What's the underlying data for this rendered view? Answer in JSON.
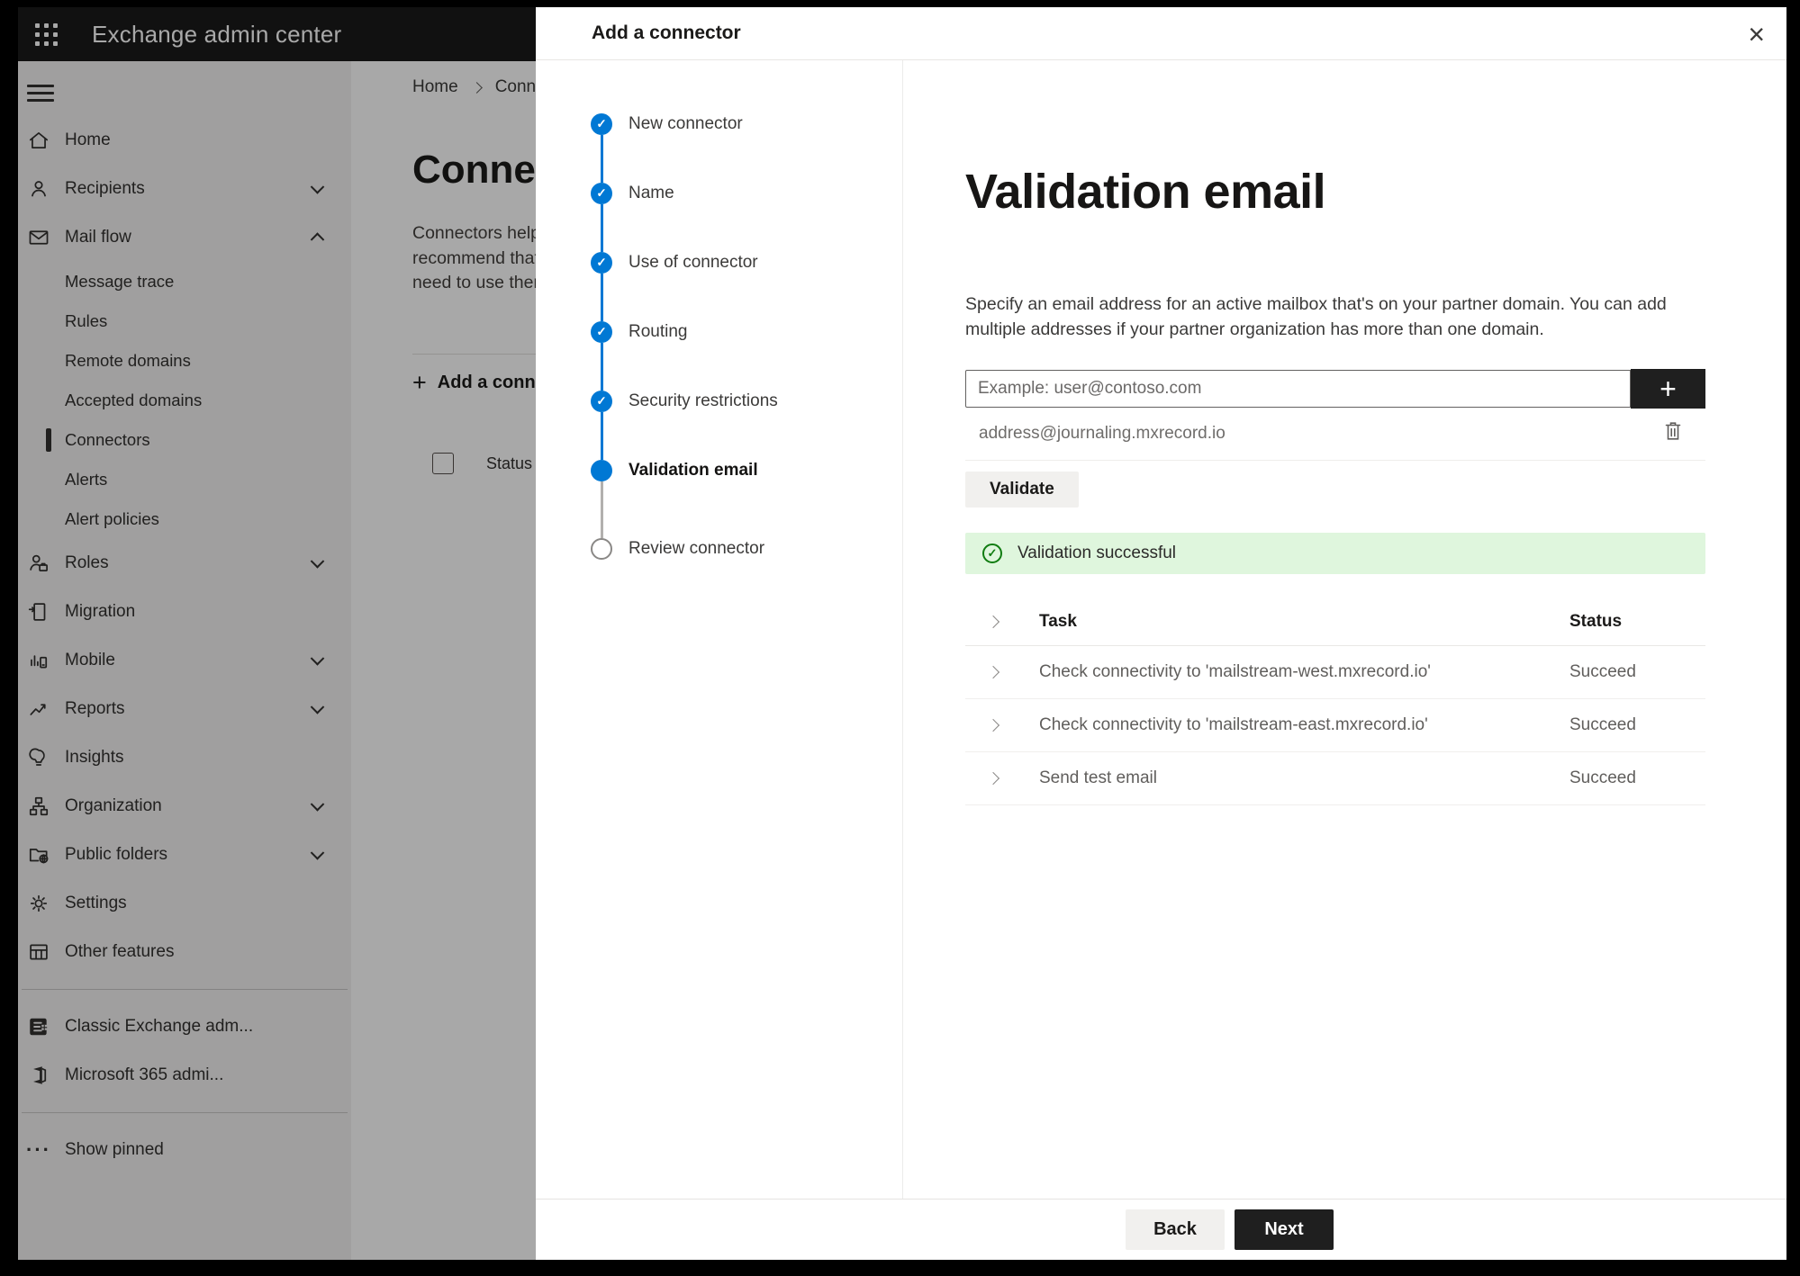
{
  "colors": {
    "accent_blue": "#0078d4",
    "topbar_bg": "#1b1b1b",
    "sidebar_bg": "#f3f2f1",
    "success_bg": "#dff6dd",
    "success_green": "#107c10",
    "dark_button": "#1f1f1f"
  },
  "topbar": {
    "title": "Exchange admin center",
    "waffle_icon": "app-launcher"
  },
  "sidebar": {
    "items": [
      {
        "label": "Home",
        "icon": "home-icon"
      },
      {
        "label": "Recipients",
        "icon": "person-icon",
        "chevron": "down"
      },
      {
        "label": "Mail flow",
        "icon": "mail-icon",
        "chevron": "up",
        "expanded": true
      },
      {
        "label": "Message trace",
        "sub": true
      },
      {
        "label": "Rules",
        "sub": true
      },
      {
        "label": "Remote domains",
        "sub": true
      },
      {
        "label": "Accepted domains",
        "sub": true
      },
      {
        "label": "Connectors",
        "sub": true,
        "selected": true
      },
      {
        "label": "Alerts",
        "sub": true
      },
      {
        "label": "Alert policies",
        "sub": true
      },
      {
        "label": "Roles",
        "icon": "roles-icon",
        "chevron": "down"
      },
      {
        "label": "Migration",
        "icon": "migration-icon"
      },
      {
        "label": "Mobile",
        "icon": "mobile-icon",
        "chevron": "down"
      },
      {
        "label": "Reports",
        "icon": "reports-icon",
        "chevron": "down"
      },
      {
        "label": "Insights",
        "icon": "insights-icon"
      },
      {
        "label": "Organization",
        "icon": "organization-icon",
        "chevron": "down"
      },
      {
        "label": "Public folders",
        "icon": "public-folders-icon",
        "chevron": "down"
      },
      {
        "label": "Settings",
        "icon": "settings-icon"
      },
      {
        "label": "Other features",
        "icon": "other-features-icon"
      },
      {
        "label": "Classic Exchange adm...",
        "icon": "classic-exchange-icon"
      },
      {
        "label": "Microsoft 365 admi...",
        "icon": "microsoft-365-icon"
      },
      {
        "label": "Show pinned",
        "icon": "ellipsis-icon",
        "glyph": "···"
      }
    ]
  },
  "page": {
    "breadcrumb": {
      "home": "Home",
      "current": "Conne"
    },
    "title": "Connec",
    "paragraph_lines": [
      "Connectors help",
      "recommend that",
      "need to use ther"
    ],
    "add_connector_label": "Add a conn",
    "add_plus_glyph": "+",
    "status_header": "Status"
  },
  "modal": {
    "title": "Add a connector",
    "close_glyph": "×",
    "check_glyph": "✓",
    "steps": [
      {
        "label": "New connector",
        "state": "done"
      },
      {
        "label": "Name",
        "state": "done"
      },
      {
        "label": "Use of connector",
        "state": "done"
      },
      {
        "label": "Routing",
        "state": "done"
      },
      {
        "label": "Security restrictions",
        "state": "done"
      },
      {
        "label": "Validation email",
        "state": "current"
      },
      {
        "label": "Review connector",
        "state": "todo"
      }
    ],
    "content": {
      "heading": "Validation email",
      "description_lines": [
        "Specify an email address for an active mailbox that's on your partner domain. You can add",
        "multiple addresses if your partner organization has more than one domain."
      ],
      "email_input": {
        "placeholder": "Example: user@contoso.com",
        "value": ""
      },
      "add_address_glyph": "+",
      "addresses": [
        "address@journaling.mxrecord.io"
      ],
      "validate_label": "Validate",
      "banner_text": "Validation successful",
      "table": {
        "task_header": "Task",
        "status_header": "Status",
        "rows": [
          {
            "task": "Check connectivity to 'mailstream-west.mxrecord.io'",
            "status": "Succeed"
          },
          {
            "task": "Check connectivity to 'mailstream-east.mxrecord.io'",
            "status": "Succeed"
          },
          {
            "task": "Send test email",
            "status": "Succeed"
          }
        ]
      }
    },
    "footer": {
      "back_label": "Back",
      "next_label": "Next"
    }
  }
}
